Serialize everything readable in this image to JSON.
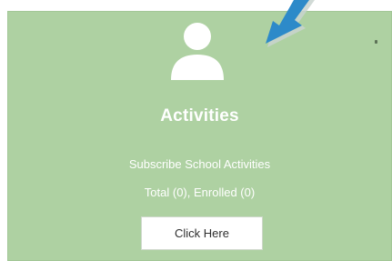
{
  "card": {
    "title": "Activities",
    "subtitle": "Subscribe School Activities",
    "counts": "Total (0), Enrolled (0)",
    "button_label": "Click Here",
    "icon": "user-icon",
    "pointer_icon": "arrow-icon"
  },
  "colors": {
    "card_background": "#aed1a2",
    "arrow": "#2d8ac9",
    "text": "#ffffff",
    "button_background": "#ffffff"
  }
}
